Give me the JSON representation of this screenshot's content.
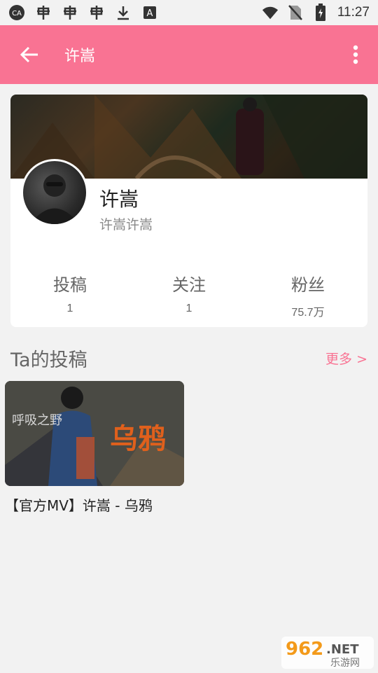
{
  "status_bar": {
    "time": "11:27",
    "icons_left": [
      "app-badge-icon",
      "bug-icon",
      "bug-icon",
      "bug-icon",
      "download-icon",
      "font-a-icon"
    ],
    "icons_right": [
      "wifi-icon",
      "no-sim-icon",
      "battery-charging-icon"
    ]
  },
  "appbar": {
    "title": "许嵩",
    "background": "#f97393"
  },
  "profile": {
    "name": "许嵩",
    "subname": "许嵩许嵩",
    "stats": [
      {
        "label": "投稿",
        "value": "1"
      },
      {
        "label": "关注",
        "value": "1"
      },
      {
        "label": "粉丝",
        "value": "75.7万"
      }
    ]
  },
  "section": {
    "title": "Ta的投稿",
    "more": "更多 >"
  },
  "videos": [
    {
      "title": "【官方MV】许嵩 - 乌鸦",
      "thumb_text_left": "呼吸之野",
      "thumb_text_right": "乌鸦"
    }
  ],
  "watermark": {
    "number": "962",
    "suffix": ".NET",
    "subtitle": "乐游网"
  },
  "colors": {
    "accent": "#f97393"
  }
}
